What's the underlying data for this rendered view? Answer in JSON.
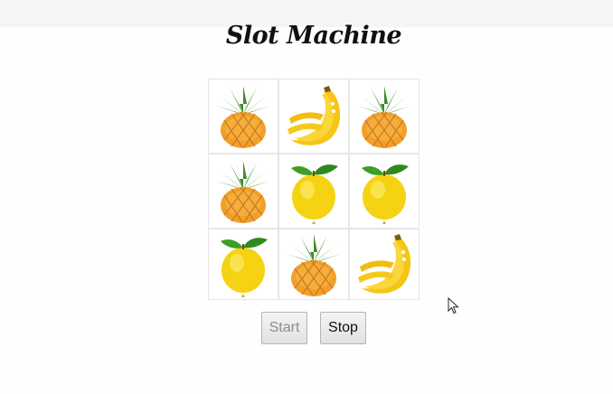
{
  "page": {
    "title": "Slot Machine"
  },
  "reels": [
    [
      "pineapple",
      "banana",
      "pineapple"
    ],
    [
      "pineapple",
      "lemon",
      "lemon"
    ],
    [
      "lemon",
      "pineapple",
      "banana"
    ]
  ],
  "controls": {
    "start_label": "Start",
    "stop_label": "Stop",
    "start_enabled": false,
    "stop_enabled": true
  }
}
